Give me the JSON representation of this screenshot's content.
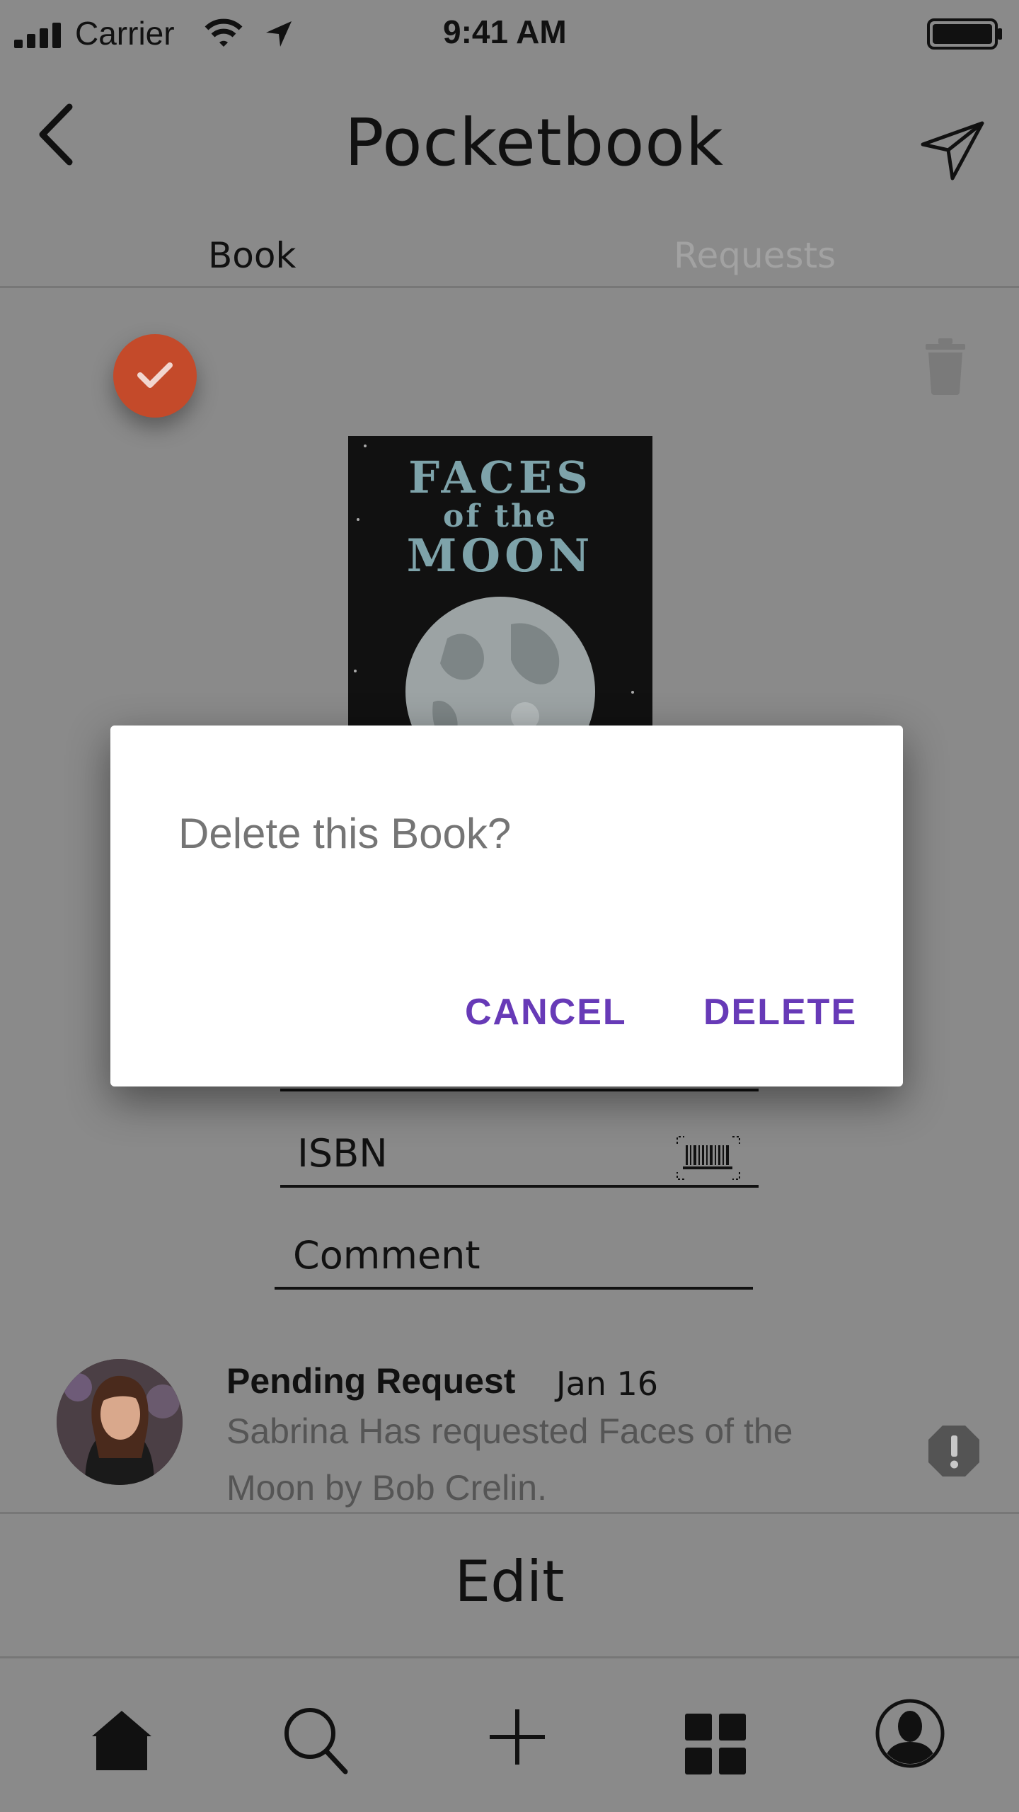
{
  "status_bar": {
    "carrier": "Carrier",
    "time": "9:41 AM"
  },
  "header": {
    "title": "Pocketbook"
  },
  "tabs": [
    {
      "label": "Book",
      "active": true
    },
    {
      "label": "Requests",
      "active": false
    }
  ],
  "book": {
    "cover_title_line1": "FACES",
    "cover_title_line2": "of the",
    "cover_title_line3": "MOON",
    "status_color": "#c44a2a"
  },
  "form": {
    "isbn_label": "ISBN",
    "comment_label": "Comment"
  },
  "request": {
    "title": "Pending Request",
    "date": "Jan 16",
    "body": "Sabrina Has requested Faces of the Moon by Bob Crelin."
  },
  "edit_label": "Edit",
  "nav": {
    "items": [
      "home-icon",
      "search-icon",
      "add-icon",
      "grid-icon",
      "profile-icon"
    ]
  },
  "dialog": {
    "title": "Delete this Book?",
    "cancel_label": "CANCEL",
    "delete_label": "DELETE",
    "accent_color": "#673ab7"
  }
}
